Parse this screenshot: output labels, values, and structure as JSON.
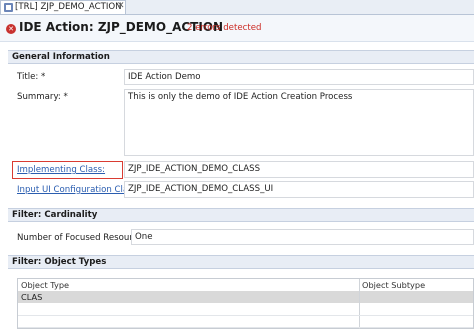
{
  "tab": {
    "label": "[TRL] ZJP_DEMO_ACTION",
    "close": "✕"
  },
  "header": {
    "title": "IDE Action: ZJP_DEMO_ACTION",
    "errors": "2 errors detected",
    "error_glyph": "✕"
  },
  "general": {
    "section_title": "General Information",
    "title_label": "Title: *",
    "title_value": "IDE Action Demo",
    "summary_label": "Summary: *",
    "summary_value": "This is only the demo of IDE Action Creation Process",
    "impl_label": "Implementing Class:",
    "impl_value": "ZJP_IDE_ACTION_DEMO_CLASS",
    "input_label": "Input UI Configuration Class:",
    "input_value": "ZJP_IDE_ACTION_DEMO_CLASS_UI"
  },
  "cardinality": {
    "section_title": "Filter: Cardinality",
    "label": "Number of Focused Resources:",
    "value": "One"
  },
  "object_types": {
    "section_title": "Filter: Object Types",
    "columns": [
      "Object Type",
      "Object Subtype"
    ],
    "rows": [
      [
        "CLAS",
        ""
      ]
    ]
  },
  "colors": {
    "link": "#2a5db0",
    "error": "#cc2b24",
    "highlight": "#d93b32"
  }
}
